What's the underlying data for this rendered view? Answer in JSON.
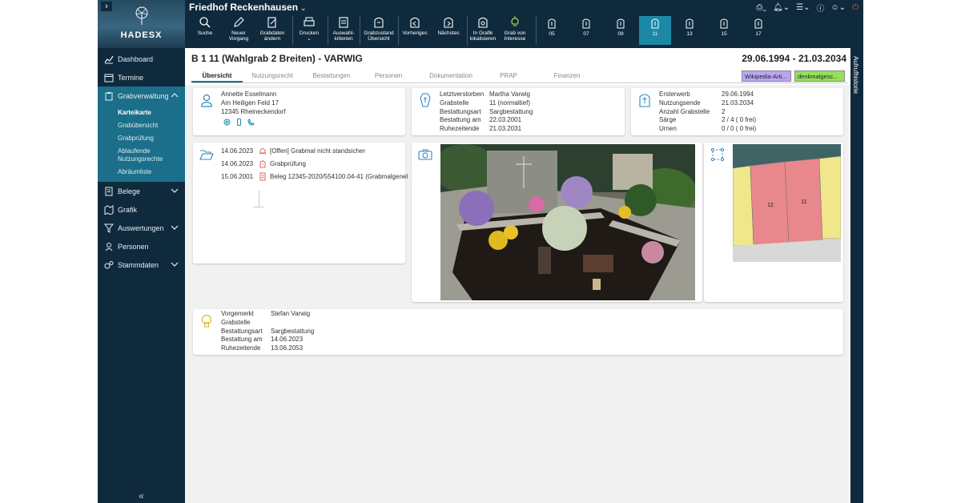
{
  "app": {
    "title": "Friedhof Reckenhausen",
    "logo_text": "HADESX"
  },
  "sidebar": {
    "items": [
      {
        "label": "Dashboard",
        "icon": "chart-line-icon"
      },
      {
        "label": "Termine",
        "icon": "calendar-icon"
      },
      {
        "label": "Grabverwaltung",
        "icon": "clipboard-icon"
      },
      {
        "label": "Belege",
        "icon": "document-icon"
      },
      {
        "label": "Grafik",
        "icon": "map-icon"
      },
      {
        "label": "Auswertungen",
        "icon": "filter-icon"
      },
      {
        "label": "Personen",
        "icon": "person-icon"
      },
      {
        "label": "Stammdaten",
        "icon": "gears-icon"
      }
    ],
    "sub_items": [
      "Karteikarte",
      "Grabübersicht",
      "Grabprüfung",
      "Ablaufende Nutzungsrechte",
      "Abräumliste"
    ],
    "collapse_glyph": "«"
  },
  "toolbar": {
    "tools": [
      {
        "label": "Suche"
      },
      {
        "label": "Neuer Vorgang"
      },
      {
        "label": "Grabdaten ändern"
      },
      {
        "label": "Drucken"
      },
      {
        "label": "Auswahl-kriterien"
      },
      {
        "label": "Grabzustand Übersicht"
      },
      {
        "label": "Vorheriges"
      },
      {
        "label": "Nächstes"
      },
      {
        "label": "In Grafik lokalisieren"
      },
      {
        "label": "Grab von Interesse"
      }
    ],
    "graves": [
      "05",
      "07",
      "09",
      "11",
      "13",
      "15",
      "17"
    ],
    "active_grave": "11"
  },
  "right_strip": {
    "label": "Aufrufhistorie"
  },
  "header": {
    "title": "B 1 11 (Wahlgrab 2 Breiten) - VARWIG",
    "dates": "29.06.1994 - 21.03.2034",
    "tabs": [
      "Übersicht",
      "Nutzungsrecht",
      "Bestattungen",
      "Personen",
      "Dokumentation",
      "PRAP",
      "Finanzen"
    ],
    "active_tab": "Übersicht",
    "tags": [
      {
        "label": "Wikipedia-Arti...",
        "color": "#b8a6f2"
      },
      {
        "label": "denkmalgesc...",
        "color": "#93e05a"
      }
    ]
  },
  "owner": {
    "name": "Annette Esselmann",
    "street": "Am Heiligen Feld 17",
    "city": "12345 Rheineckendorf"
  },
  "deceased": {
    "labels": [
      "Letztverstorben",
      "Grabstelle",
      "Bestattungsart",
      "Bestattung am",
      "Ruhezeitende"
    ],
    "values": [
      "Martha Varwig",
      "11 (normaltief)",
      "Sargbestattung",
      "22.03.2001",
      "21.03.2031"
    ]
  },
  "rights": {
    "labels": [
      "Ersterwerb",
      "Nutzungsende",
      "Anzahl Grabstelle",
      "Särge",
      "Urnen"
    ],
    "values": [
      "29.06.1994",
      "21.03.2034",
      "2",
      "2 / 4 ( 0 frei)",
      "0 / 0 ( 0 frei)"
    ]
  },
  "events": [
    {
      "date": "14.06.2023",
      "text": "[Offen] Grabmal nicht standsicher"
    },
    {
      "date": "14.06.2023",
      "text": "Grabprüfung"
    },
    {
      "date": "15.06.2001",
      "text": "Beleg 12345-2020/554100.04-41 (Grabmalgenel"
    }
  ],
  "map": {
    "plots": [
      "12",
      "11"
    ]
  },
  "reservation": {
    "labels": [
      "Vorgemerkt",
      "Grabstelle",
      "Bestattungsart",
      "Bestattung am",
      "Ruhezeitende"
    ],
    "values": [
      "Stefan Varwig",
      "",
      "Sargbestattung",
      "14.06.2023",
      "13.06.2053"
    ]
  }
}
